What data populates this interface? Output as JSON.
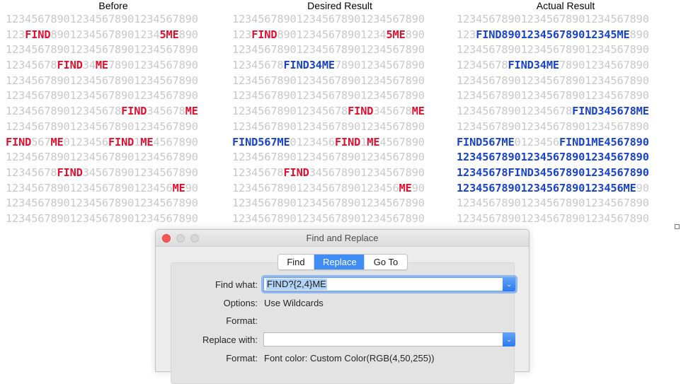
{
  "columns": [
    {
      "title": "Before",
      "lines": [
        [
          [
            "p",
            "123456789012345678901234567890"
          ]
        ],
        [
          [
            "p",
            "123"
          ],
          [
            "r",
            "FIND"
          ],
          [
            "p",
            "89012345678901234"
          ],
          [
            "r",
            "5ME"
          ],
          [
            "p",
            "890"
          ]
        ],
        [
          [
            "p",
            "123456789012345678901234567890"
          ]
        ],
        [
          [
            "p",
            "12345678"
          ],
          [
            "r",
            "FIND"
          ],
          [
            "p",
            "34"
          ],
          [
            "r",
            "ME"
          ],
          [
            "p",
            "7890123456789​0"
          ]
        ],
        [
          [
            "p",
            "123456789012345678901234567890"
          ]
        ],
        [
          [
            "p",
            "123456789012345678901234567890"
          ]
        ],
        [
          [
            "p",
            "123456789012345678"
          ],
          [
            "r",
            "FIND"
          ],
          [
            "p",
            "345678"
          ],
          [
            "r",
            "ME"
          ]
        ],
        [
          [
            "p",
            "123456789012345678901234567890"
          ]
        ],
        [
          [
            "r",
            "FIND"
          ],
          [
            "p",
            "567"
          ],
          [
            "r",
            "ME"
          ],
          [
            "p",
            "0123456"
          ],
          [
            "r",
            "FIND"
          ],
          [
            "p",
            "1"
          ],
          [
            "r",
            "ME"
          ],
          [
            "p",
            "4567890"
          ]
        ],
        [
          [
            "p",
            "123456789012345678901234567890"
          ]
        ],
        [
          [
            "p",
            "12345678"
          ],
          [
            "r",
            "FIND"
          ],
          [
            "p",
            "345678901234567890"
          ]
        ],
        [
          [
            "p",
            "1234567890123456789012345​6"
          ],
          [
            "r",
            "ME"
          ],
          [
            "p",
            "90"
          ]
        ],
        [
          [
            "p",
            "123456789012345678901234567890"
          ]
        ],
        [
          [
            "p",
            "123456789012345678901234567890"
          ]
        ]
      ]
    },
    {
      "title": "Desired Result",
      "lines": [
        [
          [
            "p",
            "123456789012345678901234567890"
          ]
        ],
        [
          [
            "p",
            "123"
          ],
          [
            "r",
            "FIND"
          ],
          [
            "p",
            "89012345678901234"
          ],
          [
            "r",
            "5ME"
          ],
          [
            "p",
            "890"
          ]
        ],
        [
          [
            "p",
            "123456789012345678901234567890"
          ]
        ],
        [
          [
            "p",
            "12345678"
          ],
          [
            "b",
            "FIND34ME"
          ],
          [
            "p",
            "7890123456789​0"
          ]
        ],
        [
          [
            "p",
            "123456789012345678901234567890"
          ]
        ],
        [
          [
            "p",
            "123456789012345678901234567890"
          ]
        ],
        [
          [
            "p",
            "123456789012345678"
          ],
          [
            "r",
            "FIND"
          ],
          [
            "p",
            "345678"
          ],
          [
            "r",
            "ME"
          ]
        ],
        [
          [
            "p",
            "123456789012345678901234567890"
          ]
        ],
        [
          [
            "b",
            "FIND567ME"
          ],
          [
            "p",
            "0123456"
          ],
          [
            "r",
            "FIND"
          ],
          [
            "p",
            "1"
          ],
          [
            "r",
            "ME"
          ],
          [
            "p",
            "4567890"
          ]
        ],
        [
          [
            "p",
            "123456789012345678901234567890"
          ]
        ],
        [
          [
            "p",
            "12345678"
          ],
          [
            "r",
            "FIND"
          ],
          [
            "p",
            "345678901234567890"
          ]
        ],
        [
          [
            "p",
            "1234567890123456789012345​6"
          ],
          [
            "r",
            "ME"
          ],
          [
            "p",
            "90"
          ]
        ],
        [
          [
            "p",
            "123456789012345678901234567890"
          ]
        ],
        [
          [
            "p",
            "123456789012345678901234567890"
          ]
        ]
      ]
    },
    {
      "title": "Actual Result",
      "lines": [
        [
          [
            "p",
            "123456789012345678901234567890"
          ]
        ],
        [
          [
            "p",
            "123"
          ],
          [
            "b",
            "FIND89012345678901234​5ME"
          ],
          [
            "p",
            "890"
          ]
        ],
        [
          [
            "p",
            "123456789012345678901234567890"
          ]
        ],
        [
          [
            "p",
            "12345678"
          ],
          [
            "b",
            "FIND34ME"
          ],
          [
            "p",
            "7890123456789​0"
          ]
        ],
        [
          [
            "p",
            "123456789012345678901234567890"
          ]
        ],
        [
          [
            "p",
            "123456789012345678901234567890"
          ]
        ],
        [
          [
            "p",
            "123456789012345678"
          ],
          [
            "b",
            "FIND345678ME"
          ]
        ],
        [
          [
            "p",
            "123456789012345678901234567890"
          ]
        ],
        [
          [
            "b",
            "FIND567ME"
          ],
          [
            "p",
            "0123456"
          ],
          [
            "b",
            "FIND1ME4567890"
          ]
        ],
        [
          [
            "b",
            "123456789012345678901234567890"
          ]
        ],
        [
          [
            "b",
            "12345678FIND345678901234567890"
          ]
        ],
        [
          [
            "b",
            "12345678901234567890123456ME"
          ],
          [
            "p",
            "90"
          ]
        ],
        [
          [
            "p",
            "123456789012345678901234567890"
          ]
        ],
        [
          [
            "p",
            "123456789012345678901234567890"
          ]
        ]
      ]
    }
  ],
  "colors": {
    "plain": "#c8c8c8",
    "found": "#e0102e",
    "replaced": "#1a44c8"
  },
  "dialog": {
    "title": "Find and Replace",
    "tabs": [
      {
        "label": "Find",
        "active": false
      },
      {
        "label": "Replace",
        "active": true
      },
      {
        "label": "Go To",
        "active": false
      }
    ],
    "find_what_label": "Find what:",
    "find_what_value": "FIND?{2,4}ME",
    "options_label": "Options:",
    "options_value": "Use Wildcards",
    "format_label": "Format:",
    "format_value": "",
    "replace_with_label": "Replace with:",
    "replace_with_value": "",
    "replace_format_label": "Format:",
    "replace_format_value": "Font color: Custom Color(RGB(4,50,255))",
    "dropdown_icon": "chevron-down-icon"
  }
}
